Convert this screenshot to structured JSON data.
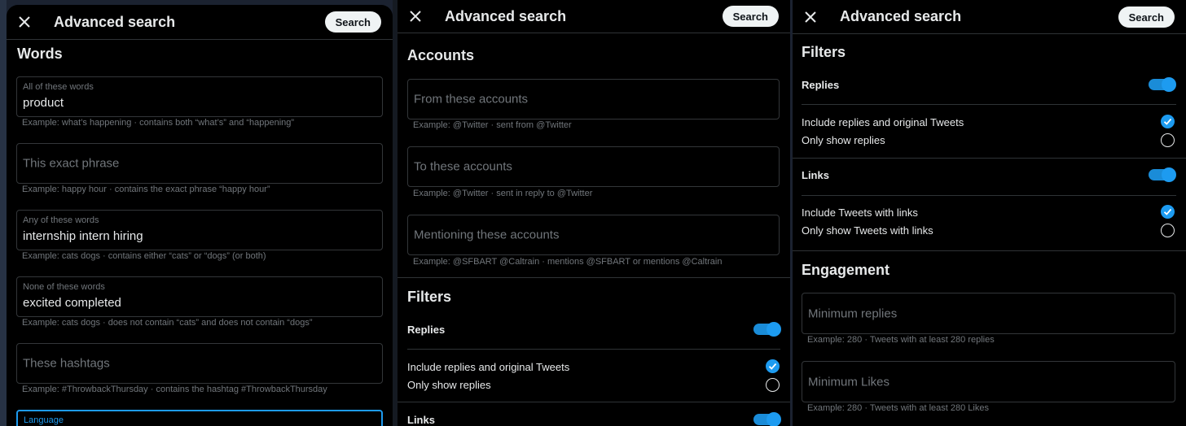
{
  "panel1": {
    "title": "Advanced search",
    "search_label": "Search",
    "section": "Words",
    "all_words": {
      "label": "All of these words",
      "value": "product",
      "hint": "Example: what’s happening · contains both “what’s” and “happening”"
    },
    "exact_phrase": {
      "placeholder": "This exact phrase",
      "hint": "Example: happy hour · contains the exact phrase “happy hour”"
    },
    "any_words": {
      "label": "Any of these words",
      "value": "internship intern hiring",
      "hint": "Example: cats dogs · contains either “cats” or “dogs” (or both)"
    },
    "none_words": {
      "label": "None of these words",
      "value": "excited completed",
      "hint": "Example: cats dogs · does not contain “cats” and does not contain “dogs”"
    },
    "hashtags": {
      "placeholder": "These hashtags",
      "hint": "Example: #ThrowbackThursday · contains the hashtag #ThrowbackThursday"
    },
    "language": {
      "label": "Language"
    }
  },
  "panel2": {
    "title": "Advanced search",
    "search_label": "Search",
    "section": "Accounts",
    "from": {
      "placeholder": "From these accounts",
      "hint": "Example: @Twitter · sent from @Twitter"
    },
    "to": {
      "placeholder": "To these accounts",
      "hint": "Example: @Twitter · sent in reply to @Twitter"
    },
    "mentioning": {
      "placeholder": "Mentioning these accounts",
      "hint": "Example: @SFBART @Caltrain · mentions @SFBART or mentions @Caltrain"
    },
    "filters_title": "Filters",
    "replies_label": "Replies",
    "replies_on": true,
    "include_replies": "Include replies and original Tweets",
    "only_replies": "Only show replies",
    "links_label": "Links",
    "links_on": true
  },
  "panel3": {
    "title": "Advanced search",
    "search_label": "Search",
    "filters_title": "Filters",
    "replies_label": "Replies",
    "replies_on": true,
    "include_replies": "Include replies and original Tweets",
    "only_replies": "Only show replies",
    "links_label": "Links",
    "links_on": true,
    "include_links": "Include Tweets with links",
    "only_links": "Only show Tweets with links",
    "engagement_title": "Engagement",
    "min_replies": {
      "placeholder": "Minimum replies",
      "hint": "Example: 280 · Tweets with at least 280 replies"
    },
    "min_likes": {
      "placeholder": "Minimum Likes",
      "hint": "Example: 280 · Tweets with at least 280 Likes"
    }
  },
  "colors": {
    "accent": "#1d9bf0",
    "background": "#000000",
    "border": "#333639",
    "muted": "#71767b",
    "text": "#e7e9ea"
  }
}
